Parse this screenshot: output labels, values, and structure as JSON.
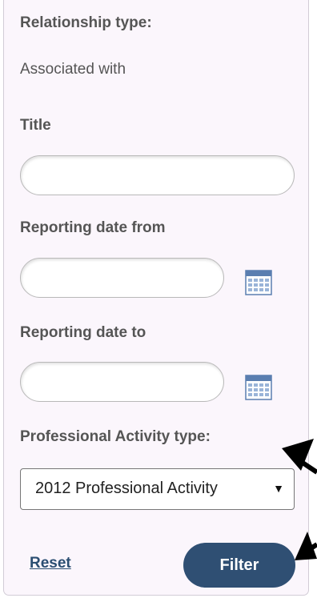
{
  "relationship": {
    "label": "Relationship type:",
    "value": "Associated with"
  },
  "title_field": {
    "label": "Title",
    "value": ""
  },
  "date_from": {
    "label": "Reporting date from",
    "value": "",
    "icon": "calendar-icon"
  },
  "date_to": {
    "label": "Reporting date to",
    "value": "",
    "icon": "calendar-icon"
  },
  "activity_type": {
    "label": "Professional Activity type:",
    "selected": "2012 Professional Activity",
    "caret": "▼"
  },
  "actions": {
    "reset_label": "Reset",
    "filter_label": "Filter"
  },
  "colors": {
    "panel_bg": "#fbf6fc",
    "label": "#555555",
    "filter_button": "#2f4f73",
    "reset_link": "#2b4e72"
  }
}
